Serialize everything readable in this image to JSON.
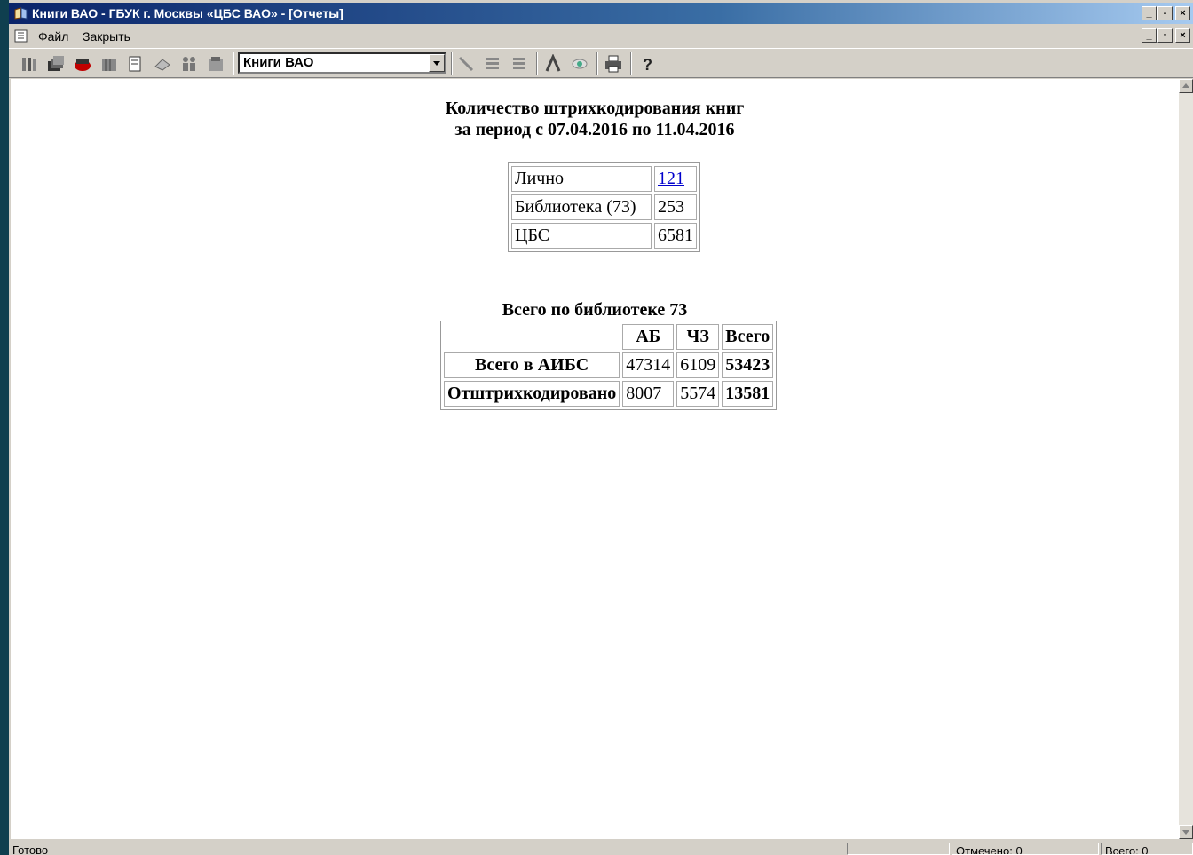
{
  "window": {
    "title": "Книги ВАО - ГБУК г. Москвы «ЦБС ВАО» - [Отчеты]"
  },
  "menu": {
    "items": [
      "Файл",
      "Закрыть"
    ]
  },
  "toolbar": {
    "combo_value": "Книги ВАО"
  },
  "report": {
    "title_line1": "Количество штрихкодирования книг",
    "title_line2": "за период с 07.04.2016 по 11.04.2016",
    "summary": [
      {
        "label": "Лично",
        "value": "121",
        "link": true
      },
      {
        "label": "Библиотека (73)",
        "value": "253",
        "link": false
      },
      {
        "label": "ЦБС",
        "value": "6581",
        "link": false
      }
    ],
    "library_title": "Всего по библиотеке 73",
    "library_table": {
      "headers": [
        "",
        "АБ",
        "ЧЗ",
        "Всего"
      ],
      "rows": [
        {
          "label": "Всего в АИБС",
          "ab": "47314",
          "chz": "6109",
          "total": "53423"
        },
        {
          "label": "Отштрихкодировано",
          "ab": "8007",
          "chz": "5574",
          "total": "13581"
        }
      ]
    }
  },
  "status": {
    "ready": "Готово",
    "panel2": "",
    "marked": "Отмечено: 0",
    "total": "Всего: 0"
  }
}
